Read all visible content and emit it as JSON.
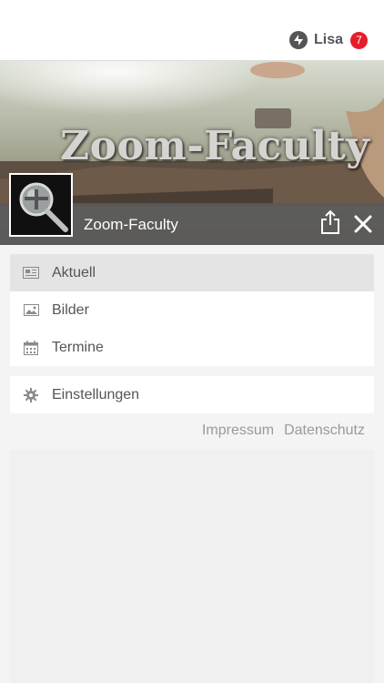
{
  "header": {
    "user_name": "Lisa",
    "notification_count": "7",
    "logo_icon": "app-logo-icon"
  },
  "banner": {
    "image_text": "Zoom-Faculty",
    "page_name": "Zoom-Faculty",
    "share_icon": "share-icon",
    "close_icon": "close-icon"
  },
  "menu": {
    "items": [
      {
        "label": "Aktuell",
        "icon": "newspaper-icon",
        "active": true
      },
      {
        "label": "Bilder",
        "icon": "image-icon",
        "active": false
      },
      {
        "label": "Termine",
        "icon": "calendar-icon",
        "active": false
      }
    ]
  },
  "settings": {
    "label": "Einstellungen",
    "icon": "gear-icon"
  },
  "footer": {
    "impressum": "Impressum",
    "datenschutz": "Datenschutz"
  },
  "colors": {
    "badge": "#e41d2b",
    "banner_bar": "#5a5a5a",
    "active_item": "#e4e4e4"
  }
}
